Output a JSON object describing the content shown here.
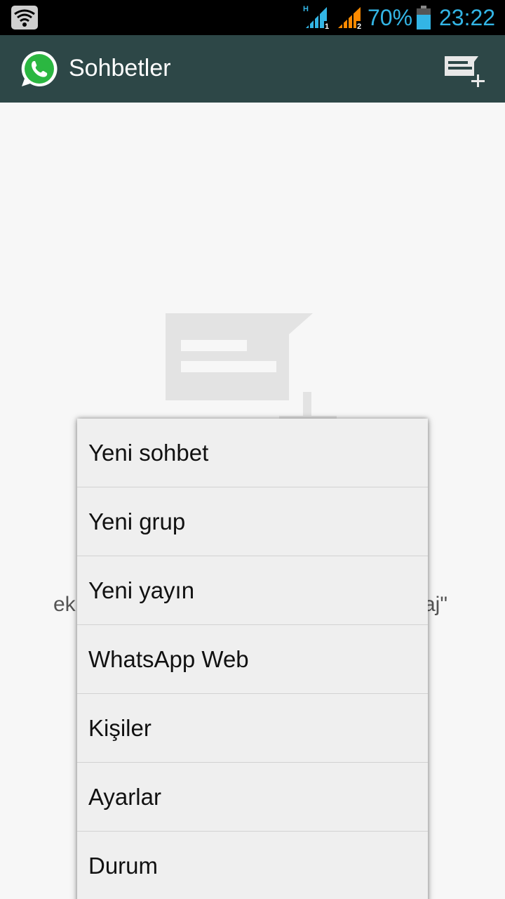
{
  "status_bar": {
    "battery_percent": "70%",
    "time": "23:22",
    "accent_color": "#33b5e5",
    "signal1": {
      "network_type": "H",
      "sim": "1"
    },
    "signal2": {
      "sim": "2"
    },
    "icons": [
      "wifi-icon",
      "signal-sim1-icon",
      "signal-sim2-icon",
      "battery-icon"
    ]
  },
  "app_bar": {
    "title": "Sohbetler",
    "background_color": "#2d4747",
    "icons": [
      "whatsapp-logo-icon",
      "new-chat-icon"
    ]
  },
  "empty_state": {
    "partial_text_left": "ek",
    "partial_text_right": "aj\""
  },
  "overflow_menu": {
    "items": [
      {
        "label": "Yeni sohbet"
      },
      {
        "label": "Yeni grup"
      },
      {
        "label": "Yeni yayın"
      },
      {
        "label": "WhatsApp Web"
      },
      {
        "label": "Kişiler"
      },
      {
        "label": "Ayarlar"
      },
      {
        "label": "Durum"
      }
    ]
  }
}
